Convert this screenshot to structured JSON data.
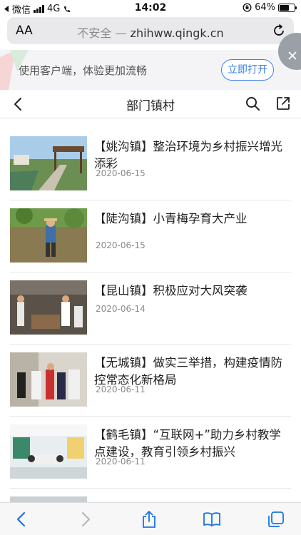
{
  "status_bar": {
    "carrier": "微信",
    "network": "4G",
    "time": "14:02",
    "battery": "64%",
    "battery_level": 0.64
  },
  "browser": {
    "text_size_label": "AA",
    "url_security": "不安全",
    "url_separator": "—",
    "url_domain": "zhihww.qingk.cn"
  },
  "banner": {
    "text": "使用客户端，体验更加流畅",
    "open_button": "立即打开"
  },
  "nav": {
    "title": "部门镇村"
  },
  "articles": [
    {
      "title": "【姚沟镇】整治环境为乡村振兴增光添彩",
      "date": "2020-06-15"
    },
    {
      "title": "【陡沟镇】小青梅孕育大产业",
      "date": "2020-06-15"
    },
    {
      "title": "【昆山镇】积极应对大风突袭",
      "date": "2020-06-14"
    },
    {
      "title": "【无城镇】做实三举措，构建疫情防控常态化新格局",
      "date": "2020-06-11"
    },
    {
      "title": "【鹤毛镇】“互联网+”助力乡村教学点建设，教育引领乡村振兴",
      "date": "2020-06-11"
    }
  ],
  "colors": {
    "accent": "#3c80e8",
    "ios_blue": "#1a73e8"
  }
}
